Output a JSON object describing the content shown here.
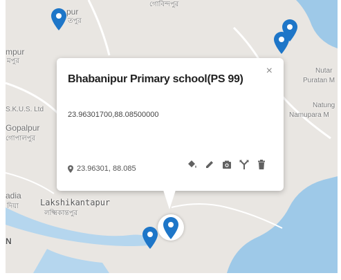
{
  "map": {
    "labels": {
      "jaypur": "pur",
      "jaypur_bn": "তপুর",
      "gobindapur_bn": "গোবিন্দপুর",
      "rampur": "mpur",
      "rampur_bn": "মপুর",
      "skus": "S.K.U.S. Ltd",
      "gopalpur": "Gopalpur",
      "gopalpur_bn": "গোপালপুর",
      "nutan": "Nutar",
      "puratan": "Puratan M",
      "natung": "Natung",
      "namupara": "Namupara M",
      "nadia": "adia",
      "nadia_bn": "দিয়া",
      "lakshikantapur": "Lakshikantapur",
      "lakshikantapur_bn": "লক্ষ্মিকান্তপুর",
      "n_letter": "N"
    },
    "colors": {
      "land": "#e9e6e2",
      "water": "#9ec9e8",
      "pin": "#1e76c8",
      "road": "#ffffff"
    }
  },
  "info_window": {
    "title": "Bhabanipur Primary school(PS 99)",
    "description": "23.96301700,88.08500000",
    "coordinates": "23.96301, 88.085",
    "close_label": "×",
    "actions": [
      "paint-bucket-icon",
      "pencil-icon",
      "camera-icon",
      "directions-icon",
      "trash-icon"
    ]
  }
}
